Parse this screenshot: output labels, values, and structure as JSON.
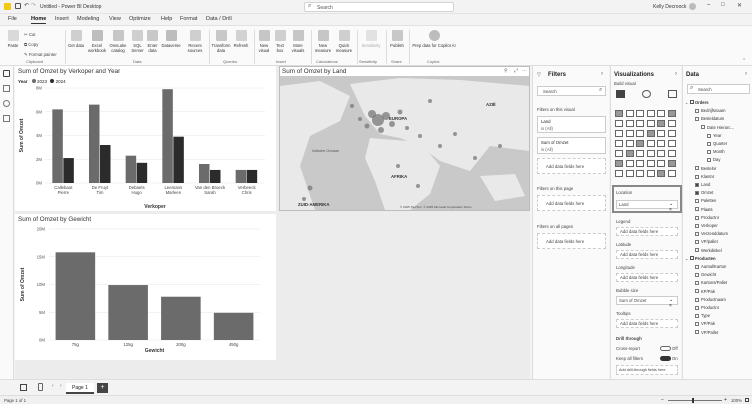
{
  "titlebar": {
    "title": "Untitled - Power BI Desktop",
    "search_placeholder": "Search",
    "user": "Kelly Decroock"
  },
  "tabs": [
    "File",
    "Home",
    "Insert",
    "Modeling",
    "View",
    "Optimize",
    "Help",
    "Format",
    "Data / Drill"
  ],
  "ribbon": {
    "clipboard": {
      "paste": "Paste",
      "cut": "Cut",
      "copy": "Copy",
      "format_painter": "Format painter",
      "group": "Clipboard"
    },
    "data": {
      "get_data": "Get data",
      "excel": "Excel workbook",
      "onelake": "OneLake catalog",
      "sql": "SQL Server",
      "enter": "Enter data",
      "dataverse": "Dataverse",
      "recent": "Recent sources",
      "group": "Data"
    },
    "queries": {
      "transform": "Transform data",
      "refresh": "Refresh",
      "group": "Queries"
    },
    "insert": {
      "new_visual": "New visual",
      "text_box": "Text box",
      "more_visuals": "More visuals",
      "group": "Insert"
    },
    "calculations": {
      "new_measure": "New measure",
      "quick_measure": "Quick measure",
      "group": "Calculations"
    },
    "sensitivity": {
      "label": "Sensitivity",
      "group": "Sensitivity"
    },
    "share": {
      "publish": "Publish",
      "group": "Share"
    },
    "copilot": {
      "prep": "Prep data for Copilot AI",
      "group": "Copilot"
    }
  },
  "visual_bar": {
    "title": "Sum of Omzet by Verkoper and Year",
    "legend_title": "Year",
    "legend": [
      "2023",
      "2024"
    ],
    "colors": {
      "y2023": "#6b6b6b",
      "y2024": "#2b2b2b"
    }
  },
  "visual_map": {
    "title": "Sum of Omzet by Land",
    "labels": {
      "europa": "EUROPA",
      "azie": "AZIË",
      "afrika": "AFRIKA",
      "zuid_amerika": "ZUID-AMERIKA",
      "oceaan": "Indische Oceaan"
    },
    "footer": "© 2025 TomTom, © 2025 Microsoft Corporation  Terms"
  },
  "visual_gewicht": {
    "title": "Sum of Omzet by Gewicht"
  },
  "chart_data": [
    {
      "type": "bar",
      "title": "Sum of Omzet by Verkoper and Year",
      "xlabel": "Verkoper",
      "ylabel": "Sum of Omzet",
      "categories": [
        "Callebaut Pierre",
        "De Fruyt Tim",
        "Debaets Hugo",
        "Leemans Marleen",
        "Van den Broeck Sarah",
        "Verbeeck Chris"
      ],
      "series": [
        {
          "name": "2023",
          "values": [
            6.2,
            6.6,
            2.3,
            7.9,
            1.6,
            1.1
          ]
        },
        {
          "name": "2024",
          "values": [
            2.1,
            3.2,
            1.7,
            3.9,
            1.1,
            1.1
          ]
        }
      ],
      "ylim": [
        0,
        8
      ],
      "yticks": [
        "0M",
        "2M",
        "4M",
        "6M",
        "8M"
      ],
      "legend": "top-left"
    },
    {
      "type": "bar",
      "title": "Sum of Omzet by Gewicht",
      "xlabel": "Gewicht",
      "ylabel": "Sum of Omzet",
      "categories": [
        "75g",
        "125g",
        "200g",
        "450g"
      ],
      "values": [
        15.8,
        9.9,
        7.8,
        4.9
      ],
      "ylim": [
        0,
        20
      ],
      "yticks": [
        "0M",
        "5M",
        "10M",
        "15M",
        "20M"
      ]
    }
  ],
  "filters": {
    "title": "Filters",
    "search": "Search",
    "on_visual": "Filters on this visual",
    "cards": [
      {
        "name": "Land",
        "value": "is (All)"
      },
      {
        "name": "Sum of Omzet",
        "value": "is (All)"
      }
    ],
    "add": "Add data fields here",
    "on_page": "Filters on this page",
    "on_all": "Filters on all pages"
  },
  "visualizations": {
    "title": "Visualizations",
    "build": "Build visual",
    "location": "Location",
    "location_value": "Land",
    "add": "Add data fields here",
    "legend": "Legend",
    "latitude": "Latitude",
    "longitude": "Longitude",
    "bubble": "Bubble size",
    "bubble_value": "Sum of Omzet",
    "tooltips": "Tooltips",
    "drill": "Drill through",
    "cross": "Cross-report",
    "cross_state": "Off",
    "keep": "Keep all filters",
    "keep_state": "On",
    "drill_add": "Add drill-through fields here"
  },
  "data_pane": {
    "title": "Data",
    "search": "Search",
    "tables": [
      {
        "name": "Orders",
        "fields": [
          {
            "name": "Bedrijfsnaam",
            "checked": false,
            "indent": 1
          },
          {
            "name": "Besteldatum",
            "checked": false,
            "indent": 1
          },
          {
            "name": "Date Hierarc...",
            "checked": false,
            "indent": 2
          },
          {
            "name": "Year",
            "checked": false,
            "indent": 3
          },
          {
            "name": "Quarter",
            "checked": false,
            "indent": 3
          },
          {
            "name": "Month",
            "checked": false,
            "indent": 3
          },
          {
            "name": "Day",
            "checked": false,
            "indent": 3
          },
          {
            "name": "Bestelnr",
            "checked": false,
            "indent": 1
          },
          {
            "name": "Klantnr",
            "checked": false,
            "indent": 1
          },
          {
            "name": "Land",
            "checked": true,
            "indent": 1
          },
          {
            "name": "Omzet",
            "checked": true,
            "indent": 1
          },
          {
            "name": "Paletten",
            "checked": false,
            "indent": 1
          },
          {
            "name": "Plaats",
            "checked": false,
            "indent": 1
          },
          {
            "name": "Productnr",
            "checked": false,
            "indent": 1
          },
          {
            "name": "Verkoper",
            "checked": false,
            "indent": 1
          },
          {
            "name": "Verzenddatum",
            "checked": false,
            "indent": 1
          },
          {
            "name": "VP/pallet",
            "checked": false,
            "indent": 1
          },
          {
            "name": "Werkdinkel",
            "checked": false,
            "indent": 1
          }
        ]
      },
      {
        "name": "Producten",
        "fields": [
          {
            "name": "Aantal/Karton",
            "checked": false,
            "indent": 1
          },
          {
            "name": "Gewicht",
            "checked": false,
            "indent": 1
          },
          {
            "name": "Kartons/Pallet",
            "checked": false,
            "indent": 1
          },
          {
            "name": "KP/Pak",
            "checked": false,
            "indent": 1
          },
          {
            "name": "Productnaam",
            "checked": false,
            "indent": 1
          },
          {
            "name": "Productnr",
            "checked": false,
            "indent": 1
          },
          {
            "name": "Type",
            "checked": false,
            "indent": 1
          },
          {
            "name": "VP/Pak",
            "checked": false,
            "indent": 1
          },
          {
            "name": "VP/Pallet",
            "checked": false,
            "indent": 1
          }
        ]
      }
    ]
  },
  "bottombar": {
    "page": "Page 1",
    "add": "+"
  },
  "status": {
    "page_info": "Page 1 of 1",
    "zoom": "100%"
  }
}
